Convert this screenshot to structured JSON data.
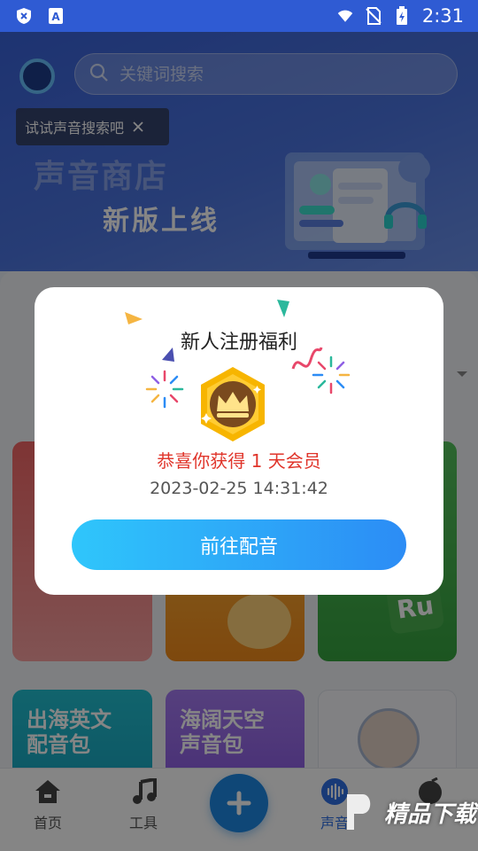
{
  "status_bar": {
    "time": "2:31"
  },
  "header": {
    "search_placeholder": "关键词搜索",
    "tooltip_text": "试试声音搜索吧",
    "banner_title": "声音商店",
    "banner_subtitle": "新版上线"
  },
  "cards": [
    {
      "title": "出海英文\n配音包"
    },
    {
      "title": "海阔天空\n声音包"
    }
  ],
  "dialog": {
    "title": "新人注册福利",
    "congrats": "恭喜你获得 1 天会员",
    "timestamp": "2023-02-25 14:31:42",
    "button_label": "前往配音"
  },
  "bottom_nav": {
    "items": [
      {
        "label": "首页",
        "icon": "home-icon"
      },
      {
        "label": "工具",
        "icon": "music-icon"
      },
      {
        "label": "",
        "icon": "plus-icon"
      },
      {
        "label": "声音",
        "icon": "sound-wave-icon"
      },
      {
        "label": "",
        "icon": "profile-icon"
      }
    ]
  },
  "watermark": "精品下载",
  "colors": {
    "accent": "#2c8cf5",
    "congrats": "#e0352b",
    "banner": "#3a63d9"
  }
}
